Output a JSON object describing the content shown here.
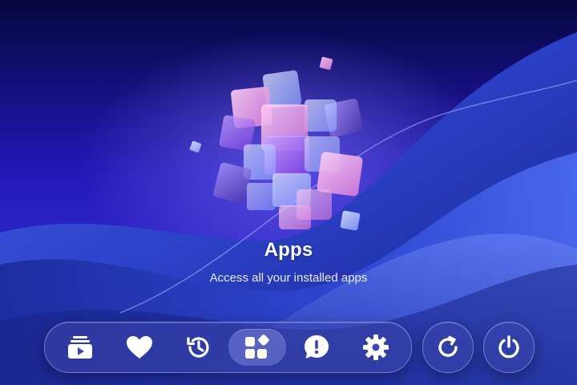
{
  "hero": {
    "title": "Apps",
    "subtitle": "Access all your installed apps"
  },
  "dock": {
    "items": [
      {
        "icon": "media-library-icon",
        "selected": false
      },
      {
        "icon": "heart-icon",
        "selected": false
      },
      {
        "icon": "history-icon",
        "selected": false
      },
      {
        "icon": "apps-grid-icon",
        "selected": true
      },
      {
        "icon": "feedback-alert-icon",
        "selected": false
      },
      {
        "icon": "gear-icon",
        "selected": false
      }
    ]
  },
  "system_buttons": [
    {
      "icon": "refresh-icon"
    },
    {
      "icon": "power-icon"
    }
  ],
  "colors": {
    "background_dark": "#0b0a4e",
    "background_mid": "#3a2fd6",
    "icon": "#ffffff",
    "cube_pink": "#f2a6e6",
    "cube_violet": "#9b5cf0"
  }
}
